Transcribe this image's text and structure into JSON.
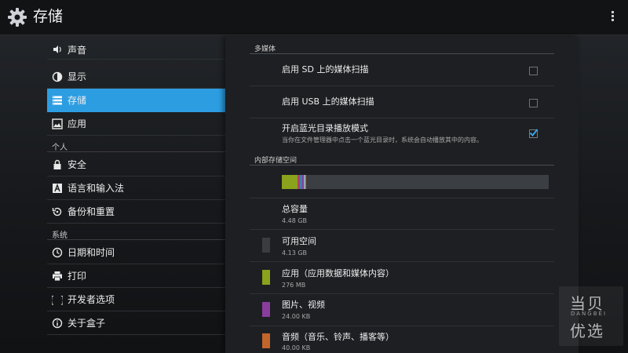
{
  "action_bar": {
    "title": "存储",
    "app_icon": "gear-icon",
    "overflow_icon": "overflow-menu-icon"
  },
  "nav": {
    "items": [
      {
        "label": "声音",
        "icon": "sound-icon"
      },
      {
        "label": "显示",
        "icon": "display-icon"
      },
      {
        "label": "存储",
        "icon": "storage-icon",
        "selected": true
      },
      {
        "label": "应用",
        "icon": "apps-icon"
      },
      {
        "label": "安全",
        "icon": "lock-icon"
      },
      {
        "label": "语言和输入法",
        "icon": "language-icon"
      },
      {
        "label": "备份和重置",
        "icon": "backup-icon"
      },
      {
        "label": "日期和时间",
        "icon": "clock-icon"
      },
      {
        "label": "打印",
        "icon": "printer-icon"
      },
      {
        "label": "开发者选项",
        "icon": "braces-icon"
      },
      {
        "label": "关于盒子",
        "icon": "info-icon"
      }
    ],
    "headers": {
      "personal": "个人",
      "system": "系统"
    }
  },
  "detail": {
    "multimedia": {
      "title": "多媒体",
      "prefs": [
        {
          "title": "启用 SD 上的媒体扫描",
          "checked": false
        },
        {
          "title": "启用 USB 上的媒体扫描",
          "checked": false
        },
        {
          "title": "开启蓝光目录播放模式",
          "summary": "当你在文件管理器中点击一个蓝光目录时，系统会自动播放其中的内容。",
          "checked": true
        }
      ]
    },
    "internal_storage": {
      "title": "内部存储空间",
      "usage_fractions": {
        "apps": 0.06,
        "pictures": 0.0055,
        "audio": 0.0045,
        "misc1": 0.009,
        "misc2": 0.008,
        "misc3": 0.006,
        "available": 0.921
      },
      "items": [
        {
          "label": "总容量",
          "value": "4.48 GB",
          "color": ""
        },
        {
          "label": "可用空间",
          "value": "4.13 GB",
          "color": "#3a3c3f"
        },
        {
          "label": "应用（应用数据和媒体内容）",
          "value": "276 MB",
          "color": "#8aa21c"
        },
        {
          "label": "图片、视频",
          "value": "24.00 KB",
          "color": "#8a3d9e"
        },
        {
          "label": "音频（音乐、铃声、播客等）",
          "value": "40.00 KB",
          "color": "#c2652b"
        }
      ],
      "bar_colors": {
        "apps": "#8aa21c",
        "pictures": "#8a3d9e",
        "audio": "#c2652b",
        "misc1": "#b0406a",
        "misc2": "#3f7fa8",
        "misc3": "#9aa3ad",
        "available": "#3b3e43"
      }
    }
  },
  "watermark": {
    "line1": "当贝",
    "line2": "DANGBEI",
    "line3": "优选"
  }
}
